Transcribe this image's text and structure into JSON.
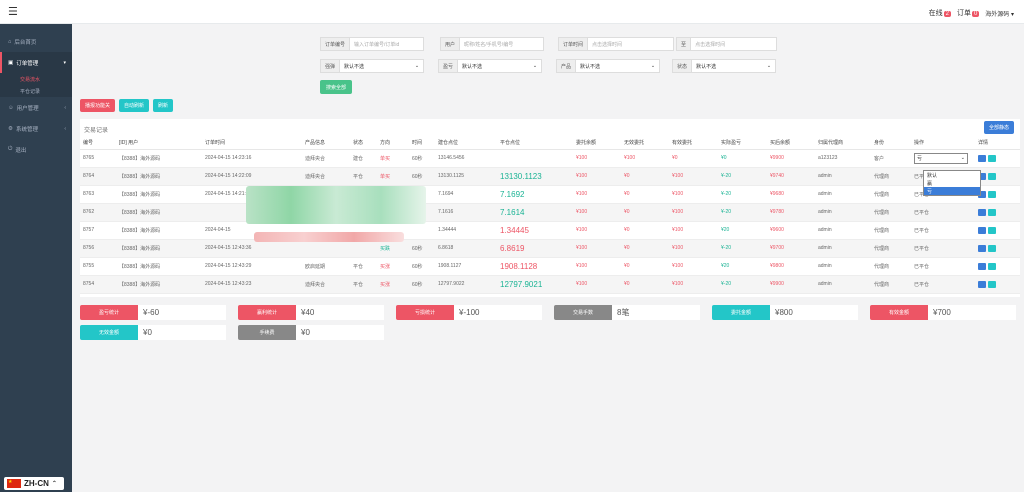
{
  "topbar": {
    "online_label": "在线",
    "online_count": "2",
    "orders_label": "订单",
    "orders_count": "0",
    "user_label": "海外源码"
  },
  "sidebar": {
    "items": [
      {
        "label": "后台首页"
      },
      {
        "label": "订单管理"
      },
      {
        "label": "用户管理"
      },
      {
        "label": "系统管理"
      },
      {
        "label": "退出"
      }
    ],
    "sub_items": [
      {
        "label": "交易流水"
      },
      {
        "label": "平仓记录"
      }
    ],
    "language": "ZH-CN"
  },
  "filters": {
    "order_no_label": "订单编号",
    "order_no_placeholder": "输入订单编号/订单id",
    "user_label": "用户",
    "user_placeholder": "昵称/姓名/手机号/编号",
    "order_time_label": "订单时间",
    "time_start_placeholder": "点击选择时间",
    "to_label": "至",
    "time_end_placeholder": "点击选择时间",
    "result_label": "强弹",
    "result_value": "默认不选",
    "profit_label": "盈亏",
    "profit_value": "默认不选",
    "product_label": "产品",
    "product_value": "默认不选",
    "status_label": "状态",
    "status_value": "默认不选",
    "search_label": "搜索全部"
  },
  "actions": {
    "btn1": "播报功能关",
    "btn2": "自动刷新",
    "btn3": "刷新"
  },
  "panel": {
    "title": "交易记录",
    "right_button": "全部静态"
  },
  "table": {
    "headers": [
      "编号",
      "[ID] 用户",
      "订单时间",
      "产品信息",
      "状态",
      "方向",
      "时间",
      "建仓点位",
      "平仓点位",
      "委托余额",
      "无效委托",
      "有效委托",
      "实际盈亏",
      "买后余额",
      "归属代理商",
      "身份",
      "操作",
      "详情"
    ],
    "rows": [
      {
        "id": "8765",
        "user": "【8388】海外源码",
        "time": "2024-04-15 14:23:16",
        "product": "迪拜央合",
        "status": "建仓",
        "dir": "单买",
        "dur": "60秒",
        "open": "13146.5456",
        "close": "",
        "entrust": "¥100",
        "invalid": "¥100",
        "valid": "¥0",
        "pnl": "¥0",
        "after": "¥9900",
        "agent": "a123123",
        "role": "客户",
        "op": "亏"
      },
      {
        "id": "8764",
        "user": "【8388】海外源码",
        "time": "2024-04-15 14:22:09",
        "product": "迪拜央合",
        "status": "平仓",
        "dir": "单买",
        "dur": "60秒",
        "open": "13130.1125",
        "close": "13130.1123",
        "entrust": "¥100",
        "invalid": "¥0",
        "valid": "¥100",
        "pnl": "¥-20",
        "after": "¥9740",
        "agent": "admin",
        "role": "代理商",
        "op": "已平仓"
      },
      {
        "id": "8763",
        "user": "【8388】海外源码",
        "time": "2024-04-15 14:21:",
        "product": "",
        "status": "",
        "dir": "",
        "dur": "",
        "open": "7.1694",
        "close": "7.1692",
        "entrust": "¥100",
        "invalid": "¥0",
        "valid": "¥100",
        "pnl": "¥-20",
        "after": "¥9680",
        "agent": "admin",
        "role": "代理商",
        "op": "已平仓"
      },
      {
        "id": "8762",
        "user": "【8388】海外源码",
        "time": "",
        "product": "",
        "status": "",
        "dir": "",
        "dur": "",
        "open": "7.1616",
        "close": "7.1614",
        "entrust": "¥100",
        "invalid": "¥0",
        "valid": "¥100",
        "pnl": "¥-20",
        "after": "¥9780",
        "agent": "admin",
        "role": "代理商",
        "op": "已平仓"
      },
      {
        "id": "8757",
        "user": "【8388】海外源码",
        "time": "2024-04-15",
        "product": "",
        "status": "",
        "dir": "",
        "dur": "",
        "open": "1.34444",
        "close": "1.34445",
        "entrust": "¥100",
        "invalid": "¥0",
        "valid": "¥100",
        "pnl": "¥20",
        "after": "¥9600",
        "agent": "admin",
        "role": "代理商",
        "op": "已平仓"
      },
      {
        "id": "8756",
        "user": "【8388】海外源码",
        "time": "2024-04-15 12:43:36",
        "product": "",
        "status": "",
        "dir": "买跌",
        "dur": "60秒",
        "open": "6.8618",
        "close": "6.8619",
        "entrust": "¥100",
        "invalid": "¥0",
        "valid": "¥100",
        "pnl": "¥-20",
        "after": "¥9700",
        "agent": "admin",
        "role": "代理商",
        "op": "已平仓"
      },
      {
        "id": "8755",
        "user": "【8388】海外源码",
        "time": "2024-04-15 12:43:29",
        "product": "欧启延期",
        "status": "平仓",
        "dir": "买涨",
        "dur": "60秒",
        "open": "1908.1127",
        "close": "1908.1128",
        "entrust": "¥100",
        "invalid": "¥0",
        "valid": "¥100",
        "pnl": "¥20",
        "after": "¥9800",
        "agent": "admin",
        "role": "代理商",
        "op": "已平仓"
      },
      {
        "id": "8754",
        "user": "【8388】海外源码",
        "time": "2024-04-15 12:43:23",
        "product": "迪拜央合",
        "status": "平仓",
        "dir": "买涨",
        "dur": "60秒",
        "open": "12797.9022",
        "close": "12797.9021",
        "entrust": "¥100",
        "invalid": "¥0",
        "valid": "¥100",
        "pnl": "¥-20",
        "after": "¥9900",
        "agent": "admin",
        "role": "代理商",
        "op": "已平仓"
      }
    ]
  },
  "dropdown": {
    "options": [
      "默认",
      "赢",
      "亏"
    ]
  },
  "stats": {
    "profit_label": "盈亏统计",
    "profit_value": "¥-60",
    "win_label": "赢利统计",
    "win_value": "¥40",
    "loss_label": "亏损统计",
    "loss_value": "¥-100",
    "trades_label": "交易手数",
    "trades_value": "8笔",
    "entrust_label": "委托金额",
    "entrust_value": "¥800",
    "valid_label": "有效金额",
    "valid_value": "¥700",
    "invalid_label": "无效金额",
    "invalid_value": "¥0",
    "fee_label": "手续费",
    "fee_value": "¥0"
  },
  "colors": {
    "sidebar": "#2f4050",
    "red": "#ed5565",
    "green": "#1ab394",
    "cyan": "#23c6c8",
    "blue": "#3b7dd8",
    "gray": "#888888"
  }
}
